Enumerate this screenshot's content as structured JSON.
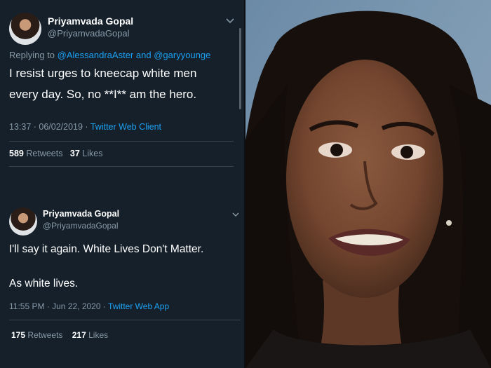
{
  "tweet1": {
    "name": "Priyamvada Gopal",
    "handle": "@PriyamvadaGopal",
    "replying_prefix": "Replying to",
    "reply_user1": "@AlessandraAster",
    "reply_and": "and",
    "reply_user2": "@garyyounge",
    "text_line1": "I resist urges to kneecap white men",
    "text_line2": "every day. So, no **I** am the hero.",
    "timestamp": "13:37 · 06/02/2019 ·",
    "client": "Twitter Web Client",
    "retweets_count": "589",
    "retweets_label": "Retweets",
    "likes_count": "37",
    "likes_label": "Likes"
  },
  "tweet2": {
    "name": "Priyamvada Gopal",
    "handle": "@PriyamvadaGopal",
    "text_line1": "I'll say it again. White Lives Don't Matter.",
    "text_line2": "As white lives.",
    "timestamp": "11:55 PM · Jun 22, 2020 ·",
    "client": "Twitter Web App",
    "retweets_count": "175",
    "retweets_label": "Retweets",
    "likes_count": "217",
    "likes_label": "Likes"
  },
  "icons": {
    "chevron": "chevron-down-icon"
  },
  "colors": {
    "background": "#15202b",
    "link": "#1da1f2",
    "secondary_text": "#8899a6",
    "divider": "#38444d"
  }
}
